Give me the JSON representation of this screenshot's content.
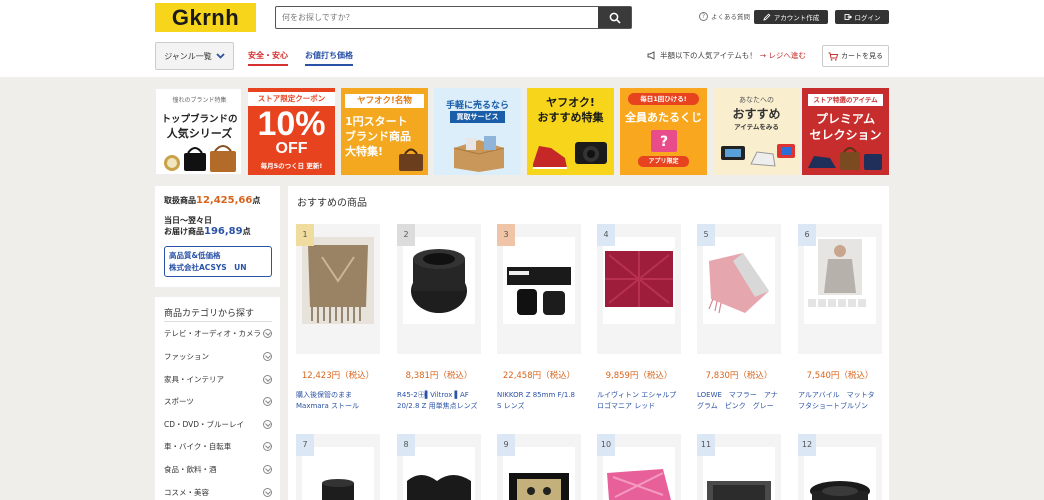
{
  "header": {
    "logo": "Gkrnh",
    "search_placeholder": "何をお探しですか？",
    "faq": "よくある質問",
    "create_account": "アカウント作成",
    "login": "ログイン"
  },
  "subnav": {
    "genre": "ジャンル一覧",
    "tab_safe": "安全・安心",
    "tab_deal": "お値打ち価格",
    "notice": "半額以下の人気アイテムも！",
    "notice_link": "→ レジへ進む",
    "cart": "カートを見る"
  },
  "banners": [
    {
      "top": "憧れのブランド特集",
      "line1": "トップブランドの",
      "line2": "人気シリーズ",
      "bg": "#ffffff",
      "fg": "#222222"
    },
    {
      "top": "ストア限定クーポン",
      "line1": "10%",
      "line2": "OFF",
      "bottom": "毎月5のつく日 更新!",
      "bg": "#e8431f",
      "fg": "#ffffff"
    },
    {
      "top": "ヤフオク!名物",
      "line1": "1円スタート",
      "line2": "ブランド商品",
      "bottom": "大特集!",
      "bg": "#f3a81f",
      "fg": "#ffffff"
    },
    {
      "top": "手軽に売るなら",
      "line1": "買取サービス",
      "bg": "#dbeefa",
      "fg": "#1a5da8"
    },
    {
      "top": "ヤフオク!",
      "line1": "おすすめ特集",
      "bg": "#f6d51b",
      "fg": "#1a1a1a"
    },
    {
      "top": "毎日1回ひける!",
      "line1": "全員あたるくじ",
      "bottom": "アプリ限定",
      "bg": "#f8a71e",
      "fg": "#ffffff"
    },
    {
      "top": "あなたへの",
      "line1": "おすすめ",
      "line2": "アイテムをみる",
      "bg": "#f9efcf",
      "fg": "#333333"
    },
    {
      "top": "ストア特選のアイテム",
      "line1": "プレミアム",
      "line2": "セレクション",
      "bg": "#c72d2d",
      "fg": "#ffffff"
    }
  ],
  "stats": {
    "items_label": "取扱商品",
    "items_count": "12,425,66",
    "items_unit": "点",
    "delivery_line1": "当日〜翌々日",
    "delivery_label": "お届け商品",
    "delivery_count": "196,89",
    "delivery_unit": "点",
    "shop_line1": "高品質&低価格",
    "shop_line2": "株式会社ACSYS　UN"
  },
  "categories": {
    "title": "商品カテゴリから探す",
    "items": [
      "テレビ・オーディオ・カメラ",
      "ファッション",
      "家具・インテリア",
      "スポーツ",
      "CD・DVD・ブルーレイ",
      "車・バイク・自転車",
      "食品・飲料・酒",
      "コスメ・美容"
    ]
  },
  "products": {
    "title": "おすすめの商品",
    "items": [
      {
        "rank": "1",
        "price": "12,423円（税込）",
        "name": "購入後保管のまま Maxmara ストール",
        "rank_color": "#f1dca0"
      },
      {
        "rank": "2",
        "price": "8,381円（税込）",
        "name": "R45-2㊉▌Viltrox ▌AF 20/2.8 Z 用単焦点レンズ",
        "rank_color": "#dcdcdc"
      },
      {
        "rank": "3",
        "price": "22,458円（税込）",
        "name": "NIKKOR Z 85mm F/1.8 S レンズ",
        "rank_color": "#efc4a7"
      },
      {
        "rank": "4",
        "price": "9,859円（税込）",
        "name": "ルイヴィトン エシャルプロゴマニア レッド",
        "rank_color": "#dbe7f5"
      },
      {
        "rank": "5",
        "price": "7,830円（税込）",
        "name": "LOEWE　マフラー　アナグラム　ピンク　グレー",
        "rank_color": "#dbe7f5"
      },
      {
        "rank": "6",
        "price": "7,540円（税込）",
        "name": "アルアバイル　マットタフタショートブルゾン",
        "rank_color": "#dbe7f5"
      },
      {
        "rank": "7",
        "rank_color": "#dbe7f5"
      },
      {
        "rank": "8",
        "rank_color": "#dbe7f5"
      },
      {
        "rank": "9",
        "rank_color": "#dbe7f5"
      },
      {
        "rank": "10",
        "rank_color": "#dbe7f5"
      },
      {
        "rank": "11",
        "rank_color": "#dbe7f5"
      },
      {
        "rank": "12",
        "rank_color": "#dbe7f5"
      }
    ]
  }
}
